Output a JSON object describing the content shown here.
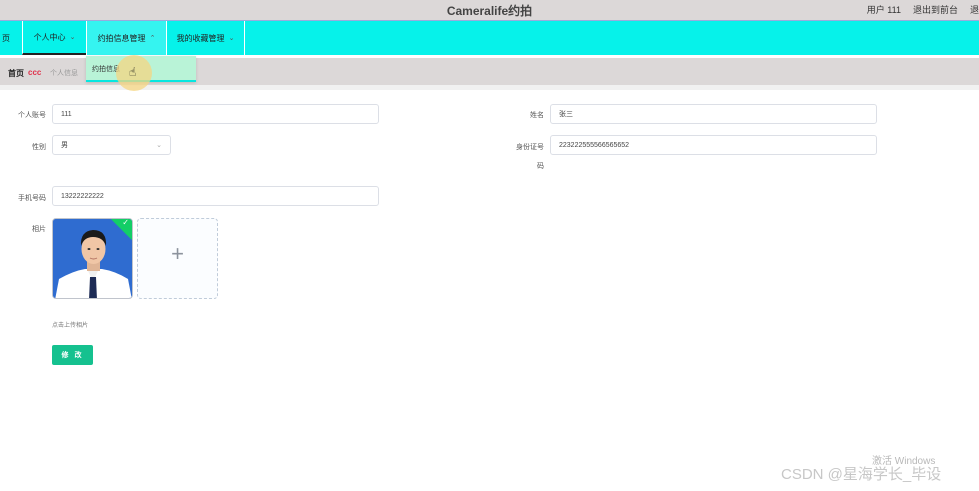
{
  "header": {
    "app_title": "Cameralife约拍",
    "user_label": "用户 111",
    "exit_label": "退出到前台",
    "logout_label": "退"
  },
  "nav": {
    "home": "页",
    "personal": "个人中心",
    "appointment": "约拍信息管理",
    "favorites": "我的收藏管理",
    "dropdown_item": "约拍信息"
  },
  "breadcrumb": {
    "home": "首页",
    "separator": "ccc",
    "current": "个人信息"
  },
  "form": {
    "account_label": "个人账号",
    "account_value": "111",
    "name_label": "姓名",
    "name_value": "张三",
    "gender_label": "性别",
    "gender_value": "男",
    "id_label_line1": "身份证号",
    "id_label_line2": "码",
    "id_value": "223222555566565652",
    "phone_label": "手机号码",
    "phone_value": "13222222222",
    "photo_label": "相片",
    "upload_hint": "点击上传相片",
    "submit_label": "修 改"
  },
  "watermarks": {
    "windows": "激活 Windows",
    "csdn": "CSDN @星海学长_毕设"
  },
  "colors": {
    "navbar": "#06f2ea",
    "topbar": "#dcd8d8",
    "accent_button": "#15c18f",
    "breadcrumb_separator": "#e0334d",
    "upload_check": "#13ce66"
  },
  "icons": {
    "nav_chevron": "chevron-down-icon",
    "nav_chevron_open": "chevron-up-icon",
    "select_arrow": "chevron-down-icon",
    "upload": "plus-icon",
    "upload_success": "check-icon",
    "cursor": "hand-pointer-icon"
  }
}
